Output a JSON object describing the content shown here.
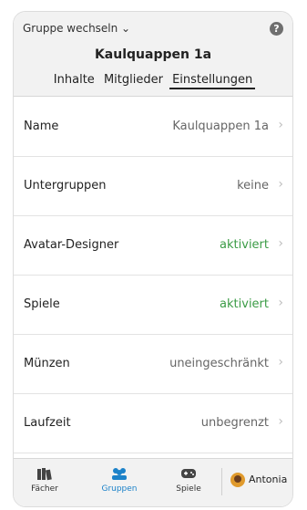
{
  "header": {
    "switch_label": "Gruppe wechseln ⌄",
    "help_label": "?",
    "title": "Kaulquappen 1a",
    "tabs": [
      "Inhalte",
      "Mitglieder",
      "Einstellungen"
    ],
    "active_tab": "Einstellungen"
  },
  "settings": [
    {
      "label": "Name",
      "value": "Kaulquappen 1a",
      "accent": false
    },
    {
      "label": "Untergruppen",
      "value": "keine",
      "accent": false
    },
    {
      "label": "Avatar-Designer",
      "value": "aktiviert",
      "accent": true
    },
    {
      "label": "Spiele",
      "value": "aktiviert",
      "accent": true
    },
    {
      "label": "Münzen",
      "value": "uneingeschränkt",
      "accent": false
    },
    {
      "label": "Laufzeit",
      "value": "unbegrenzt",
      "accent": false
    }
  ],
  "chevron": "›",
  "bottom_nav": {
    "items": [
      {
        "label": "Fächer",
        "icon": "books-icon"
      },
      {
        "label": "Gruppen",
        "icon": "group-icon"
      },
      {
        "label": "Spiele",
        "icon": "gamepad-icon"
      }
    ],
    "user": "Antonia"
  },
  "colors": {
    "accent_green": "#3a9b45",
    "active_blue": "#1c82c9",
    "header_bg": "#f2f2f2"
  }
}
